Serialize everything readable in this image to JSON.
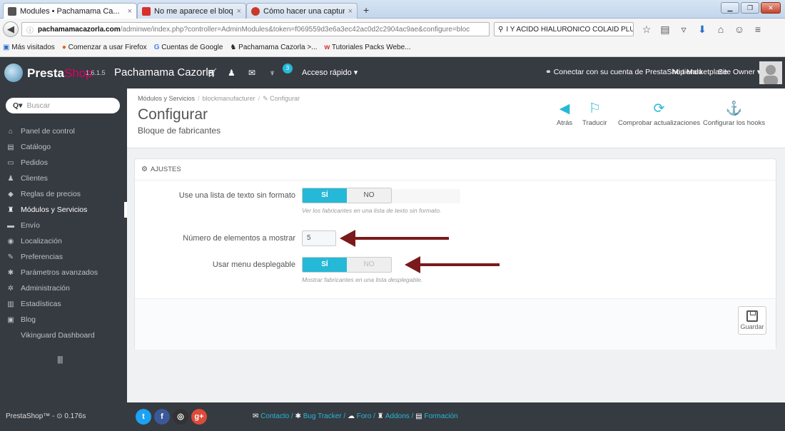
{
  "browser": {
    "tabs": [
      {
        "label": "Modules • Pachamama Ca...",
        "favicon_color": "#555555"
      },
      {
        "label": "No me aparece el bloque d...",
        "favicon_color": "#d9302c"
      },
      {
        "label": "Cómo hacer una captura d...",
        "favicon_color": "#c83a2c"
      }
    ],
    "tab_close": "×",
    "new_tab": "+",
    "url_domain": "pachamamacazorla.com",
    "url_path": "/adminwe/index.php?controller=AdminModules&token=f069559d3e6a3ec42ac0d2c2904ac9ae&configure=bloc",
    "search_text": "I Y ACIDO HIALURONICO COLAID PLUS",
    "bookmarks": [
      "Más visitados",
      "Comenzar a usar Firefox",
      "Cuentas de Google",
      "Pachamama Cazorla >...",
      "Tutoriales Packs Webe..."
    ]
  },
  "header": {
    "brand_presta": "Presta",
    "brand_shop": "Shop",
    "version": "1.6.1.5",
    "shop_name": "Pachamama Cazorla",
    "notification_count": "3",
    "quick_access": "Acceso rápido ▾",
    "marketplace": "Conectar con su cuenta de PrestaShop Marketplace",
    "my_store": "Mi tienda",
    "user": "Site Owner ▾"
  },
  "sidebar": {
    "search_placeholder": "Buscar",
    "items": [
      {
        "label": "Panel de control",
        "icon": "⌂"
      },
      {
        "label": "Catálogo",
        "icon": "▤"
      },
      {
        "label": "Pedidos",
        "icon": "▭"
      },
      {
        "label": "Clientes",
        "icon": "♟"
      },
      {
        "label": "Reglas de precios",
        "icon": "◆"
      },
      {
        "label": "Módulos y Servicios",
        "icon": "♜"
      },
      {
        "label": "Envío",
        "icon": "▬"
      },
      {
        "label": "Localización",
        "icon": "◉"
      },
      {
        "label": "Preferencias",
        "icon": "✎"
      },
      {
        "label": "Parámetros avanzados",
        "icon": "✱"
      },
      {
        "label": "Administración",
        "icon": "✲"
      },
      {
        "label": "Estadísticas",
        "icon": "▥"
      },
      {
        "label": "Blog",
        "icon": "▣"
      },
      {
        "label": "Vikinguard Dashboard",
        "icon": ""
      }
    ],
    "active_index": 5,
    "collapse": "||||"
  },
  "toolbar": {
    "breadcrumb_1": "Módulos y Servicios",
    "breadcrumb_2": "blockmanufacturer",
    "breadcrumb_3": "Configurar",
    "breadcrumb_sep": "/",
    "title": "Configurar",
    "subtitle": "Bloque de fabricantes",
    "buttons": [
      {
        "label": "Atrás",
        "icon": "◀"
      },
      {
        "label": "Traducir",
        "icon": "⚐"
      },
      {
        "label": "Comprobar actualizaciones",
        "icon": "⟳"
      },
      {
        "label": "Configurar los hooks",
        "icon": "⚓"
      }
    ]
  },
  "panel": {
    "heading": "AJUSTES",
    "fields": {
      "text_list_label": "Use una lista de texto sin formato",
      "text_list_yes": "SÍ",
      "text_list_no": "NO",
      "text_list_help": "Ver los fabricantes en una lista de texto sin formato.",
      "count_label": "Número de elementos a mostrar",
      "count_value": "5",
      "dropdown_label": "Usar menu desplegable",
      "dropdown_yes": "SÍ",
      "dropdown_no": "NO",
      "dropdown_help": "Mostrar fabricantes en una lista desplegable."
    },
    "save_label": "Guardar"
  },
  "footer": {
    "version": "PrestaShop™ - ⊙ 0.176s",
    "links": [
      "Contacto",
      "Bug Tracker",
      "Foro",
      "Addons",
      "Formación"
    ],
    "link_sep": "/"
  },
  "colors": {
    "accent": "#25b9d7",
    "brand_pink": "#df0067",
    "dark": "#363a41",
    "arrow": "#7a1a1a"
  }
}
